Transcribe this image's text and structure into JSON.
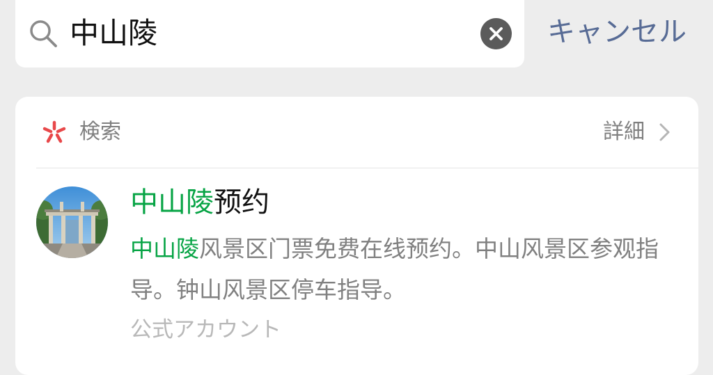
{
  "search": {
    "query": "中山陵",
    "cancel_label": "キャンセル"
  },
  "card": {
    "header_label": "検索",
    "detail_label": "詳細",
    "result": {
      "title_highlight": "中山陵",
      "title_rest": "预约",
      "desc_highlight": "中山陵",
      "desc_rest": "风景区门票免费在线预约。中山风景区参观指导。钟山风景区停车指导。",
      "meta": "公式アカウント"
    }
  },
  "icons": {
    "search": "search-icon",
    "clear": "clear-icon",
    "search_brand": "search-brand-icon",
    "chevron": "chevron-right-icon"
  },
  "colors": {
    "accent_link": "#576b95",
    "highlight": "#07a445",
    "brand_icon": "#e8484a"
  }
}
